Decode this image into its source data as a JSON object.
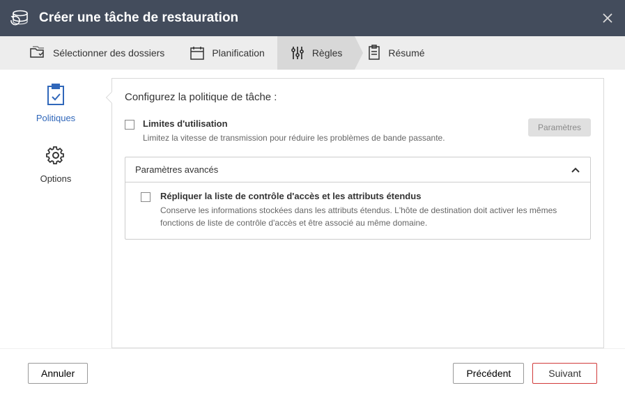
{
  "header": {
    "title": "Créer une tâche de restauration"
  },
  "steps": {
    "select_folders": "Sélectionner des dossiers",
    "planning": "Planification",
    "rules": "Règles",
    "summary": "Résumé"
  },
  "left_nav": {
    "policies": "Politiques",
    "options": "Options"
  },
  "panel": {
    "title": "Configurez la politique de tâche :",
    "usage_limits": {
      "label": "Limites d'utilisation",
      "description": "Limitez la vitesse de transmission pour réduire les problèmes de bande passante.",
      "settings_button": "Paramètres"
    },
    "advanced": {
      "header": "Paramètres avancés",
      "acl": {
        "label": "Répliquer la liste de contrôle d'accès et les attributs étendus",
        "description": "Conserve les informations stockées dans les attributs étendus. L'hôte de destination doit activer les mêmes fonctions de liste de contrôle d'accès et être associé au même domaine."
      }
    }
  },
  "footer": {
    "cancel": "Annuler",
    "previous": "Précédent",
    "next": "Suivant"
  }
}
